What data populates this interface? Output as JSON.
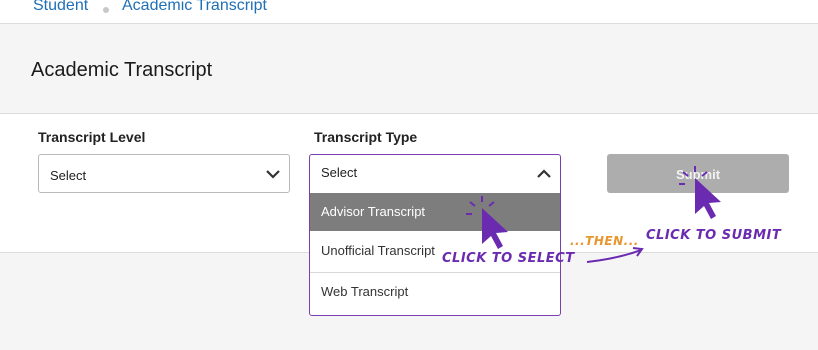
{
  "breadcrumb": {
    "items": [
      "Student",
      "Academic Transcript"
    ]
  },
  "page": {
    "title": "Academic Transcript"
  },
  "form": {
    "transcript_level": {
      "label": "Transcript Level",
      "value": "Select"
    },
    "transcript_type": {
      "label": "Transcript Type",
      "value": "Select",
      "expanded": true,
      "options": [
        "Advisor Transcript",
        "Unofficial Transcript",
        "Web Transcript"
      ],
      "highlighted_option": "Advisor Transcript"
    },
    "submit_label": "Submit"
  },
  "annotations": {
    "click_select": "CLICK TO SELECT",
    "then": "...THEN...",
    "click_submit": "CLICK TO SUBMIT"
  },
  "colors": {
    "link": "#1f6fb5",
    "annotation_purple": "#6a2bb0",
    "annotation_orange": "#e8952e",
    "dropdown_border": "#7a3fb0",
    "selected_option_bg": "#7d7d7d",
    "submit_disabled_bg": "#adadad"
  }
}
